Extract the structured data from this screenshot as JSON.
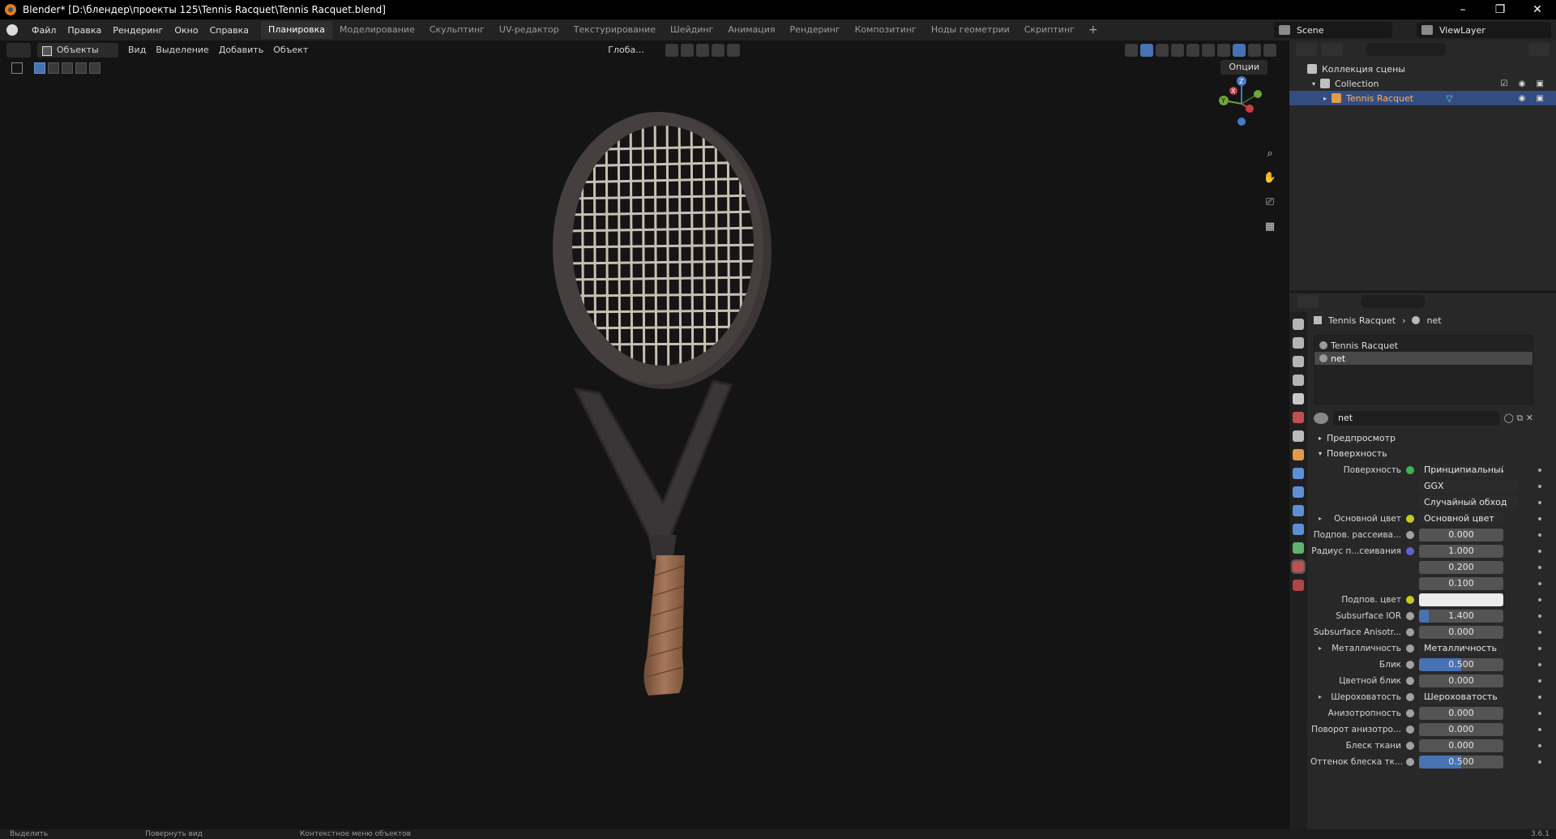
{
  "window": {
    "title": "Blender* [D:\\блендер\\проекты 125\\Tennis Racquet\\Tennis Racquet.blend]"
  },
  "menu": [
    "Файл",
    "Правка",
    "Рендеринг",
    "Окно",
    "Справка"
  ],
  "workspaces": {
    "active": "Планировка",
    "tabs": [
      "Моделирование",
      "Скульптинг",
      "UV-редактор",
      "Текстурирование",
      "Шейдинг",
      "Анимация",
      "Рендеринг",
      "Композитинг",
      "Ноды геометрии",
      "Скриптинг"
    ]
  },
  "scene": {
    "name": "Scene",
    "view_layer": "ViewLayer"
  },
  "viewport": {
    "mode": "Объекты",
    "menus": [
      "Вид",
      "Выделение",
      "Добавить",
      "Объект"
    ],
    "orientation": "Глоба...",
    "options_label": "Опции"
  },
  "outliner": {
    "root": "Коллекция сцены",
    "collection": "Collection",
    "object": "Tennis Racquet"
  },
  "properties": {
    "breadcrumb_object": "Tennis Racquet",
    "breadcrumb_material": "net",
    "slots": [
      "Tennis Racquet",
      "net"
    ],
    "material_name": "net",
    "section_preview": "Предпросмотр",
    "section_surface": "Поверхность",
    "rows": [
      {
        "label": "Поверхность",
        "value": "Принципиальный BSDF",
        "kind": "link",
        "dot": "#3fb34f"
      },
      {
        "label": "",
        "value": "GGX",
        "kind": "drop"
      },
      {
        "label": "",
        "value": "Случайный обход",
        "kind": "drop"
      },
      {
        "label": "Основной цвет",
        "value": "Основной цвет",
        "kind": "link",
        "dot": "#c7c729",
        "expand": true
      },
      {
        "label": "Подпов. рассеива...",
        "value": "0.000",
        "kind": "num",
        "dot": "#a1a1a1"
      },
      {
        "label": "Радиус п...сеивания",
        "value": "1.000",
        "kind": "num",
        "dot": "#6363c7"
      },
      {
        "label": "",
        "value": "0.200",
        "kind": "num"
      },
      {
        "label": "",
        "value": "0.100",
        "kind": "num"
      },
      {
        "label": "Подпов. цвет",
        "value": "",
        "kind": "color",
        "dot": "#c7c729"
      },
      {
        "label": "Subsurface IOR",
        "value": "1.400",
        "kind": "num",
        "dot": "#a1a1a1",
        "fill": 0.12
      },
      {
        "label": "Subsurface Anisotr...",
        "value": "0.000",
        "kind": "num",
        "dot": "#a1a1a1"
      },
      {
        "label": "Металличность",
        "value": "Металличность",
        "kind": "link",
        "dot": "#a1a1a1",
        "expand": true
      },
      {
        "label": "Блик",
        "value": "0.500",
        "kind": "num",
        "dot": "#a1a1a1",
        "fill": 0.5
      },
      {
        "label": "Цветной блик",
        "value": "0.000",
        "kind": "num",
        "dot": "#a1a1a1"
      },
      {
        "label": "Шероховатость",
        "value": "Шероховатость",
        "kind": "link",
        "dot": "#a1a1a1",
        "expand": true
      },
      {
        "label": "Анизотропность",
        "value": "0.000",
        "kind": "num",
        "dot": "#a1a1a1"
      },
      {
        "label": "Поворот анизотро...",
        "value": "0.000",
        "kind": "num",
        "dot": "#a1a1a1"
      },
      {
        "label": "Блеск ткани",
        "value": "0.000",
        "kind": "num",
        "dot": "#a1a1a1"
      },
      {
        "label": "Оттенок блеска тк...",
        "value": "0.500",
        "kind": "num",
        "dot": "#a1a1a1",
        "fill": 0.5
      }
    ]
  },
  "status": {
    "select": "Выделить",
    "rotate": "Повернуть вид",
    "context": "Контекстное меню объектов",
    "version": "3.6.1"
  },
  "colors": {
    "accent": "#4772b3",
    "selection": "#334d80",
    "viewport_bg": "#141414"
  }
}
